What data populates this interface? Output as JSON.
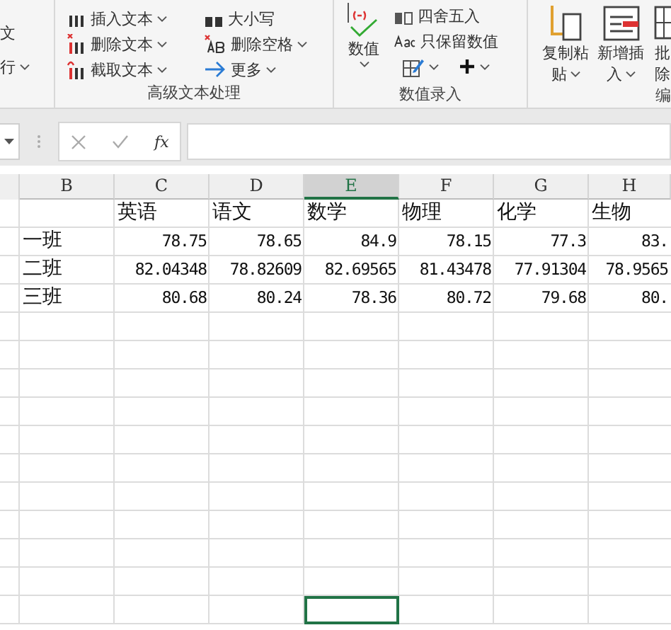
{
  "ribbon": {
    "left_group": {
      "items": [
        {
          "label": "文",
          "dropdown": false
        },
        {
          "label": "行",
          "dropdown": true
        }
      ]
    },
    "text_group": {
      "label": "高级文本处理",
      "items": [
        {
          "kind": "insert",
          "label": "插入文本",
          "dropdown": true
        },
        {
          "kind": "delete",
          "label": "删除文本",
          "dropdown": true
        },
        {
          "kind": "extract",
          "label": "截取文本",
          "dropdown": true
        },
        {
          "kind": "case",
          "label": "大小写",
          "dropdown": false
        },
        {
          "kind": "delete-space",
          "label": "删除空格",
          "dropdown": true
        },
        {
          "kind": "more",
          "label": "更多",
          "dropdown": true
        }
      ]
    },
    "number_group": {
      "label": "数值录入",
      "big": {
        "label": "数值",
        "dropdown": true
      },
      "items": [
        {
          "kind": "round",
          "label": "四舍五入",
          "dropdown": false
        },
        {
          "kind": "keep-value",
          "label": "只保留数值",
          "dropdown": false
        }
      ],
      "tools": [
        {
          "kind": "edit",
          "dropdown": true
        },
        {
          "kind": "plus",
          "dropdown": true
        }
      ]
    },
    "edit_group": {
      "label": "编",
      "buttons": [
        {
          "kind": "copy",
          "label_lines": [
            "复制粘",
            "贴"
          ],
          "dropdown": true
        },
        {
          "kind": "insert-row",
          "label_lines": [
            "新增插",
            "入"
          ],
          "dropdown": true
        },
        {
          "kind": "batch",
          "label_lines": [
            "批",
            "除"
          ],
          "dropdown": false
        }
      ]
    }
  },
  "formula_bar": {
    "fx": "fx"
  },
  "sheet": {
    "columns": [
      {
        "label": "B",
        "selected": false
      },
      {
        "label": "C",
        "selected": false
      },
      {
        "label": "D",
        "selected": false
      },
      {
        "label": "E",
        "selected": true
      },
      {
        "label": "F",
        "selected": false
      },
      {
        "label": "G",
        "selected": false
      },
      {
        "label": "H",
        "selected": false
      }
    ],
    "header_row": [
      "英语",
      "语文",
      "数学",
      "物理",
      "化学",
      "生物"
    ],
    "data_rows": [
      {
        "label": "一班",
        "values": [
          "78.75",
          "78.65",
          "84.9",
          "78.15",
          "77.3",
          "83."
        ]
      },
      {
        "label": "二班",
        "values": [
          "82.04348",
          "78.82609",
          "82.69565",
          "81.43478",
          "77.91304",
          "78.9565"
        ]
      },
      {
        "label": "三班",
        "values": [
          "80.68",
          "80.24",
          "78.36",
          "80.72",
          "79.68",
          "80."
        ]
      }
    ],
    "blank_rows": [
      {
        "selected": false
      },
      {
        "selected": false
      },
      {
        "selected": false
      },
      {
        "selected": false
      },
      {
        "selected": false
      },
      {
        "selected": false
      },
      {
        "selected": false
      },
      {
        "selected": false
      },
      {
        "selected": false
      },
      {
        "selected": false
      },
      {
        "selected": true
      }
    ]
  }
}
